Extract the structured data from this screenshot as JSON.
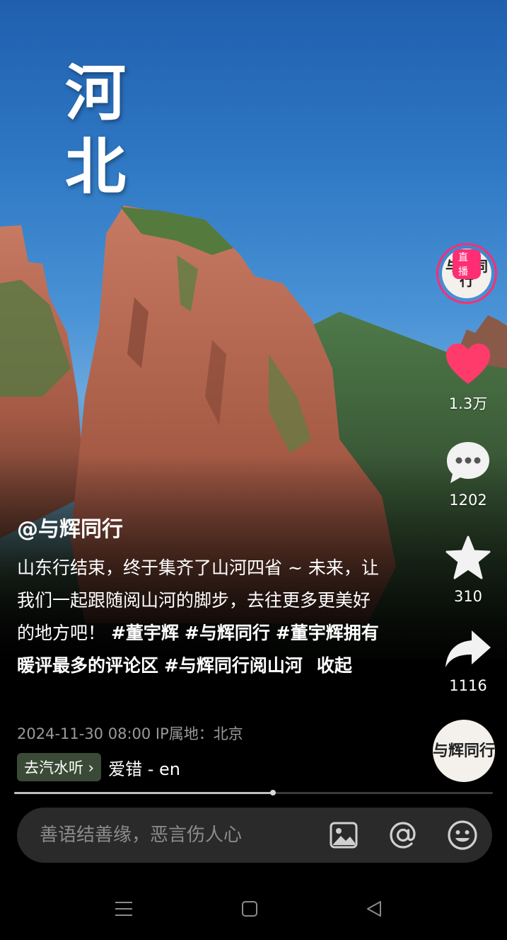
{
  "video": {
    "overlay_line1": "河",
    "overlay_line2": "北"
  },
  "rail": {
    "live_badge": "直播",
    "avatar_text": "与辉同行",
    "like_count": "1.3万",
    "comment_count": "1202",
    "favorite_count": "310",
    "share_count": "1116",
    "disc_text": "与辉同行",
    "colors": {
      "live_ring": "#ff2d73",
      "like": "#ff3b6b"
    }
  },
  "caption": {
    "author": "@与辉同行",
    "text": "山东行结束，终于集齐了山河四省 ~ 未来，让我们一起跟随阅山河的脚步，去往更多更美好的地方吧！",
    "tags": [
      "#董宇辉",
      "#与辉同行",
      "#董宇辉拥有暖评最多的评论区",
      "#与辉同行阅山河"
    ],
    "collapse_label": "收起",
    "meta": "2024-11-30 08:00  IP属地：北京"
  },
  "music": {
    "chip_label": "去汽水听 ›",
    "title": "爱错 - en"
  },
  "progress": {
    "fraction": 0.54
  },
  "comment_bar": {
    "placeholder": "善语结善缘，恶言伤人心",
    "icons": [
      "image-icon",
      "at-icon",
      "emoji-icon"
    ]
  },
  "navbar": {
    "icons": [
      "menu-icon",
      "home-icon",
      "back-icon"
    ]
  }
}
